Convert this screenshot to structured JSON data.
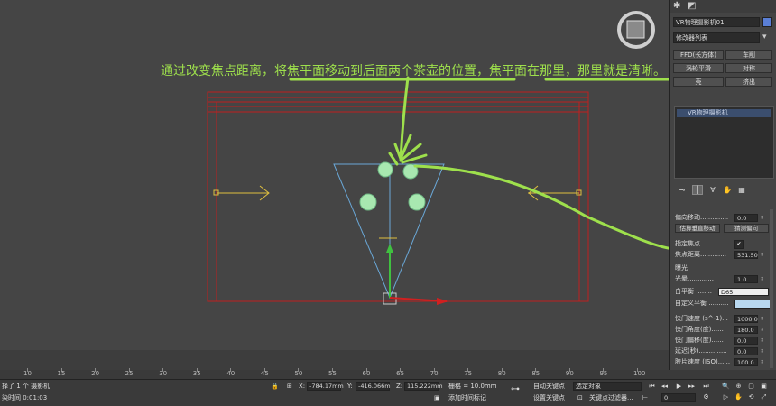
{
  "annotation": "通过改变焦点距离，将焦平面移动到后面两个茶壶的位置，焦平面在那里，那里就是清晰。",
  "panel": {
    "object_name": "VR物理摄影机01",
    "object_color": "#5a7fd6",
    "modifier_list": "修改器列表",
    "buttons": [
      "FFD(长方体)",
      "车削",
      "涡轮平滑",
      "对称",
      "壳",
      "挤出"
    ],
    "stack_item": "VR物理摄影机",
    "params": {
      "shift_label": "偏向移动..............",
      "shift_value": "0.0",
      "estimate_vertical": "估算垂直移动",
      "guess_horizontal": "猜测偏向",
      "specify_focus_label": "指定焦点.............",
      "specify_focus_checked": "✔",
      "focus_distance_label": "焦点距离.............",
      "focus_distance_value": "531.50",
      "exposure_label": "曝光",
      "vignetting_label": "光晕.............",
      "vignetting_value": "1.0",
      "white_balance_label": "白平衡 ........",
      "white_balance_value": "D65",
      "custom_wb_label": "自定义平衡 ..........",
      "shutter_speed_label": "快门速度 (s^-1)...",
      "shutter_speed_value": "1000.0",
      "shutter_angle_label": "快门角度(度)......",
      "shutter_angle_value": "180.0",
      "shutter_offset_label": "快门偏移(度)......",
      "shutter_offset_value": "0.0",
      "latency_label": "延迟(秒)..............",
      "latency_value": "0.0",
      "iso_label": "胶片速度 (ISO)......",
      "iso_value": "100.0"
    }
  },
  "timeline": {
    "ticks": [
      "10",
      "15",
      "20",
      "25",
      "30",
      "35",
      "40",
      "45",
      "50",
      "55",
      "60",
      "65",
      "70",
      "75",
      "80",
      "85",
      "90",
      "95",
      "100"
    ]
  },
  "status": {
    "selected": "择了 1 个 摄影机",
    "time": "染时间 0:01:03",
    "x_label": "X:",
    "x_value": "-784.17mm",
    "y_label": "Y:",
    "y_value": "-416.066m",
    "z_label": "Z:",
    "z_value": "115.222mm",
    "grid": "栅格 = 10.0mm",
    "auto_key": "自动关键点",
    "selection_set": "选定对象",
    "set_key": "设置关键点",
    "key_filters": "关键点过滤器...",
    "add_time_tag": "添加时间标记",
    "frame": "0"
  }
}
